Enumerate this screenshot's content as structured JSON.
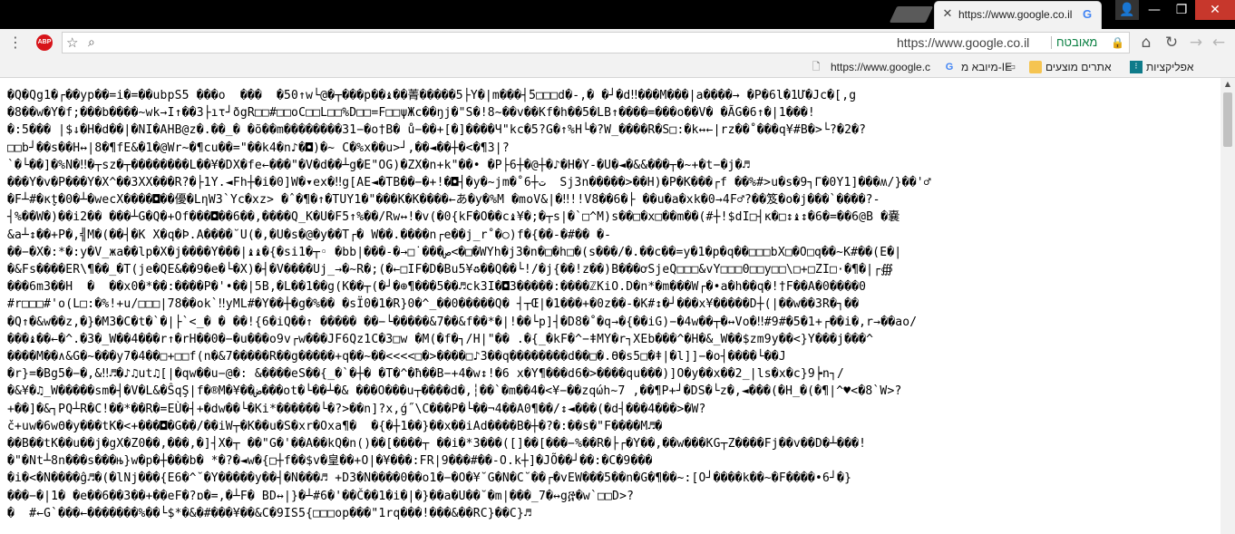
{
  "window": {
    "tab_title": "https://www.google.co.il",
    "tab_favicon": "G",
    "tab_close_glyph": "✕",
    "controls": {
      "user": "👤",
      "minimize": "—",
      "maximize": "❐",
      "close": "✕"
    }
  },
  "toolbar": {
    "menu_glyph": "⋮",
    "abp_label": "ABP",
    "star_glyph": "☆",
    "search_glyph": "⌕",
    "url": "https://www.google.co.il",
    "secure_label": "מאובטח",
    "lock_glyph": "🔒",
    "home_glyph": "⌂",
    "reload_glyph": "↻",
    "forward_glyph": "→",
    "back_glyph": "←"
  },
  "bookmarks": [
    {
      "label": "אפליקציות",
      "icon": "apps-icon",
      "glyph": "⁝"
    },
    {
      "label": "אתרים מוצעים",
      "icon": "folder-icon",
      "glyph": ""
    },
    {
      "label": "מיובא מ-IE",
      "icon": "folder-icon",
      "glyph": "▭"
    },
    {
      "label": "https://www.google.c",
      "icon": "google-icon",
      "glyph": "G"
    },
    {
      "label": "",
      "icon": "page-icon",
      "glyph": "🗋"
    }
  ],
  "page": {
    "garbled_lines": [
      "�Q�Qg1�┌��yp��=i�=��ubpS5 ���o  ���  �50↑w└@�┬���p��♝��菁�����5├Y�|m���┤̈5□□□d�-,� �┘�d‼���M���|a����→ �P�6l�1Ư�Jc�[,g",
      "�8��w�Y�f;���b����~wk→I↑��3├ıτ┘ðgR□□#□□oC□□L□□%D□□=F□□ψЖc��ŋj�\"S�!8~��v��Kf�h��5�LB↑����=���o��V� �ÃG�6↑�|1���!",
      "�:5��� |$↓�H�d��|�NI�AHB@z�.��_� �õ��m��������31−�o†B� ů−��+[�]����Ч\"kc�5?G�↑%H└�?W_����R�S□:�k↔←|rz��˚���q¥#B�>└?�2�?",
      "□□b┘��s��H↔|8�¶fE&�1�@Wr~�¶cu��=\"��k4�n♪�◘)�~ C�%x��u>┘,��◄��┼�<�¶3|?",
      "`�└��]�%N�‼�┬sz�┬��������L��¥�DX�fe←���\"�V�d��┴g�E\"OG)�ZX�n+k\"��• �P├6┼�@┼�♪�H�Y-�U�◄�&&���┬�~+�t−�j�♬",
      "���Y�v�P���Y�X^��3XX�︎��R?�├1Y.◄Fh┼�i�0]W�▾ex�‼g[AE◄�TB��−�+!�◘┤�y�~jm�˚6┼ت  Sj3n�����>��H)�P�K���┌f ��%#>u�s�9┐Γ�0Y1]���ʍ/}��'♂",
      "�F┴#�κ̬t�0�┴�wecX����◘��優�LηW3`Yc�xz> �ˆ�¶�↑�TUY1�\"���K�K����←あ�y�%M �moV&|�‼!!V8��6�├ ��u�a�xk�0→4F♂?��笈�o�j���`����?-",
      "┤%��W�)��i2�� ���┴G�Q�+Of���◘��6��,����Q_K�U�F5↑%��/Rw↔!�v(�0{kF�O��c♝¥�;�┬s|�`□^M)s��□�x□��m��(#┼!$dI□┤κ�□↕♝↕�6�=��6@B �嚢",
      "&a┴↕��+P�,╣M�(��┤�K X�q�Þ.A����˘U(�,�U�s�@�y��T┌� W��.����n┌e��j_r˚�○)f�{��-�#�� �-",
      "��−�X�:*�:y�V_жa��lp�X�j����Y���|♝♝�{�si1�┬◦ �bb|���-�→□˙���ص<�□�WYh�j3�n�□�h□�(s���/�.��c��=y�1�p�q��□□□bX□�O□q��~K#��(E�|",
      "�&Fs����ER\\¶��_�T(je�QE&��9�e�└�X)�┤�V����Uj_→�~R�;(�←□IF�D�Bu5¥♻��Q��└!/�j{��!z��)B���ơSjeQ□□□&vY□□□0□□y□□\\□+□ZI□·�¶�|┌∰",
      "���6m3��H  �  ��x0�*��:����P�'•��|5B,�L��1��g(K��┬(�┘�⊕¶���5��♬ck3I�◘3�����:����ℤKiO.D�n*�m���W┌�•a�h��q�!†F��A�0����0",
      "#r□□□#'o(L□:�%!+u/□□□|78��ok`‼yML#�Y��┼�g�%�� �sΪ0�1�R}0�^_��0�����Q� ┤┬Œ|�1���+�0z��-�K#↕�┘���x¥�����D┼(|��w��3R�┐��",
      "�Q↑�&w��z,�}�M3�C�t�`�|├`<_� � ��!{6�iQ��↑ ����� ��−└�����&7��&f��*�|!��└p]┤�D8�˚�q→�{��iG)−�4w��┬�↔Vo�‼#9#�5�1+┌��i�,r→��ao/",
      "���♝��←�^.�3�_W��4���r↑�rH��0�−�u���o9v┌w���JF6Qz1C�3□w �M(�f�┐/H|\"�� .�{_�kF�^−ǂMY�r┐XEb���^�H�&_W��$zm9y��<}Y���j���^",
      "����M��∧&G�~���y7�4��□+□□f(n�&7�����R��g�����+q��~��<<<<□�>����□♪3��q��������d��□�.ϴ�s5□�ǂ|�l]]−�o┤����└��J",
      "�r}=�Bg5�−�,&‼♬�♪♫ut♫[|�qw��u−@�: &����eS��{_�`�┼� �T�^�ħ��B−+4�w↕!�6 x�Y¶���d6�>����qu���)]O�y��x��2_|ls�x�c}9┝n┐/",
      "�&¥�♫_W�����sm�┤�V�L&�ŜqŞ|f�®M�¥��ض���ot�└��┴�& ���O���u┬����d�,┆��`�m��4�<¥−��zqώh~7 ,��¶P+┘�DS�└z�,◄���(�H_�(�¶|^♥<�8`W>?",
      "+��]�&┐PQ┴R�C!��*��R�=EÙ�┤+�dw��└�Ki*������└�?>��n]?x,ǵ˝\\C���P�└��¬4��A0¶��/↕◄���(�d┤���4���>�W?",
      "č+uw�6wΘ�y���tK�<+���◘�G��/��iW┬�K��u�S�xr�Oxa¶�  �{�┼1��}��x��iAd����B�┼�?�:��s�\"F����M♬�",
      "��B��tK��u��j�gX�Z0��,���,�]┤X�┬ ��\"G�'��A��kQ�n()��[����┬ ��i�*3���([]��[���−%��R�├┌�Y��,��w���KG┬Z����Fj��v��D�┴���!",
      "�\"�Nt┴8n���s���њ}w�p�┼���b� *�?�◄w�{□┼f��$v�皇��+O|�¥���:FR|9���#��-O.k┼]�JÕ��┘��:�C�9���",
      "�i�<�N����ĝ♬�(�lNj���{E6�^˘�Y�����y��┤�N���♬ +D3�N����0��o1�−�O�¥˘G�N�C˘��┌�vEW���5��n�G�¶��~:[O┘����k��~�F����•6┘�}",
      "���−�|1� �e��6��3��+��eF�?ɒ�=,�┴F� BD↔|}�┴#6�'��Č��1�i�|�}��a�U��˘�m|���_7�↔g፸�w`□□D>?",
      "�  #←G`���←�������%��└$*�&�#���¥��&C�9IS5{□□□op���\"1rq���!���&��RC}��C}♬"
    ]
  }
}
